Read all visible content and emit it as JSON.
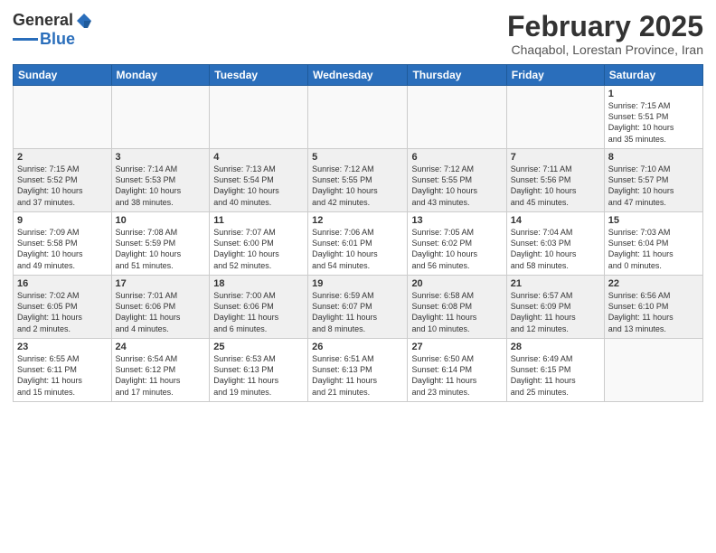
{
  "logo": {
    "general": "General",
    "blue": "Blue"
  },
  "header": {
    "month": "February 2025",
    "location": "Chaqabol, Lorestan Province, Iran"
  },
  "weekdays": [
    "Sunday",
    "Monday",
    "Tuesday",
    "Wednesday",
    "Thursday",
    "Friday",
    "Saturday"
  ],
  "weeks": [
    [
      {
        "day": "",
        "info": ""
      },
      {
        "day": "",
        "info": ""
      },
      {
        "day": "",
        "info": ""
      },
      {
        "day": "",
        "info": ""
      },
      {
        "day": "",
        "info": ""
      },
      {
        "day": "",
        "info": ""
      },
      {
        "day": "1",
        "info": "Sunrise: 7:15 AM\nSunset: 5:51 PM\nDaylight: 10 hours\nand 35 minutes."
      }
    ],
    [
      {
        "day": "2",
        "info": "Sunrise: 7:15 AM\nSunset: 5:52 PM\nDaylight: 10 hours\nand 37 minutes."
      },
      {
        "day": "3",
        "info": "Sunrise: 7:14 AM\nSunset: 5:53 PM\nDaylight: 10 hours\nand 38 minutes."
      },
      {
        "day": "4",
        "info": "Sunrise: 7:13 AM\nSunset: 5:54 PM\nDaylight: 10 hours\nand 40 minutes."
      },
      {
        "day": "5",
        "info": "Sunrise: 7:12 AM\nSunset: 5:55 PM\nDaylight: 10 hours\nand 42 minutes."
      },
      {
        "day": "6",
        "info": "Sunrise: 7:12 AM\nSunset: 5:55 PM\nDaylight: 10 hours\nand 43 minutes."
      },
      {
        "day": "7",
        "info": "Sunrise: 7:11 AM\nSunset: 5:56 PM\nDaylight: 10 hours\nand 45 minutes."
      },
      {
        "day": "8",
        "info": "Sunrise: 7:10 AM\nSunset: 5:57 PM\nDaylight: 10 hours\nand 47 minutes."
      }
    ],
    [
      {
        "day": "9",
        "info": "Sunrise: 7:09 AM\nSunset: 5:58 PM\nDaylight: 10 hours\nand 49 minutes."
      },
      {
        "day": "10",
        "info": "Sunrise: 7:08 AM\nSunset: 5:59 PM\nDaylight: 10 hours\nand 51 minutes."
      },
      {
        "day": "11",
        "info": "Sunrise: 7:07 AM\nSunset: 6:00 PM\nDaylight: 10 hours\nand 52 minutes."
      },
      {
        "day": "12",
        "info": "Sunrise: 7:06 AM\nSunset: 6:01 PM\nDaylight: 10 hours\nand 54 minutes."
      },
      {
        "day": "13",
        "info": "Sunrise: 7:05 AM\nSunset: 6:02 PM\nDaylight: 10 hours\nand 56 minutes."
      },
      {
        "day": "14",
        "info": "Sunrise: 7:04 AM\nSunset: 6:03 PM\nDaylight: 10 hours\nand 58 minutes."
      },
      {
        "day": "15",
        "info": "Sunrise: 7:03 AM\nSunset: 6:04 PM\nDaylight: 11 hours\nand 0 minutes."
      }
    ],
    [
      {
        "day": "16",
        "info": "Sunrise: 7:02 AM\nSunset: 6:05 PM\nDaylight: 11 hours\nand 2 minutes."
      },
      {
        "day": "17",
        "info": "Sunrise: 7:01 AM\nSunset: 6:06 PM\nDaylight: 11 hours\nand 4 minutes."
      },
      {
        "day": "18",
        "info": "Sunrise: 7:00 AM\nSunset: 6:06 PM\nDaylight: 11 hours\nand 6 minutes."
      },
      {
        "day": "19",
        "info": "Sunrise: 6:59 AM\nSunset: 6:07 PM\nDaylight: 11 hours\nand 8 minutes."
      },
      {
        "day": "20",
        "info": "Sunrise: 6:58 AM\nSunset: 6:08 PM\nDaylight: 11 hours\nand 10 minutes."
      },
      {
        "day": "21",
        "info": "Sunrise: 6:57 AM\nSunset: 6:09 PM\nDaylight: 11 hours\nand 12 minutes."
      },
      {
        "day": "22",
        "info": "Sunrise: 6:56 AM\nSunset: 6:10 PM\nDaylight: 11 hours\nand 13 minutes."
      }
    ],
    [
      {
        "day": "23",
        "info": "Sunrise: 6:55 AM\nSunset: 6:11 PM\nDaylight: 11 hours\nand 15 minutes."
      },
      {
        "day": "24",
        "info": "Sunrise: 6:54 AM\nSunset: 6:12 PM\nDaylight: 11 hours\nand 17 minutes."
      },
      {
        "day": "25",
        "info": "Sunrise: 6:53 AM\nSunset: 6:13 PM\nDaylight: 11 hours\nand 19 minutes."
      },
      {
        "day": "26",
        "info": "Sunrise: 6:51 AM\nSunset: 6:13 PM\nDaylight: 11 hours\nand 21 minutes."
      },
      {
        "day": "27",
        "info": "Sunrise: 6:50 AM\nSunset: 6:14 PM\nDaylight: 11 hours\nand 23 minutes."
      },
      {
        "day": "28",
        "info": "Sunrise: 6:49 AM\nSunset: 6:15 PM\nDaylight: 11 hours\nand 25 minutes."
      },
      {
        "day": "",
        "info": ""
      }
    ]
  ]
}
